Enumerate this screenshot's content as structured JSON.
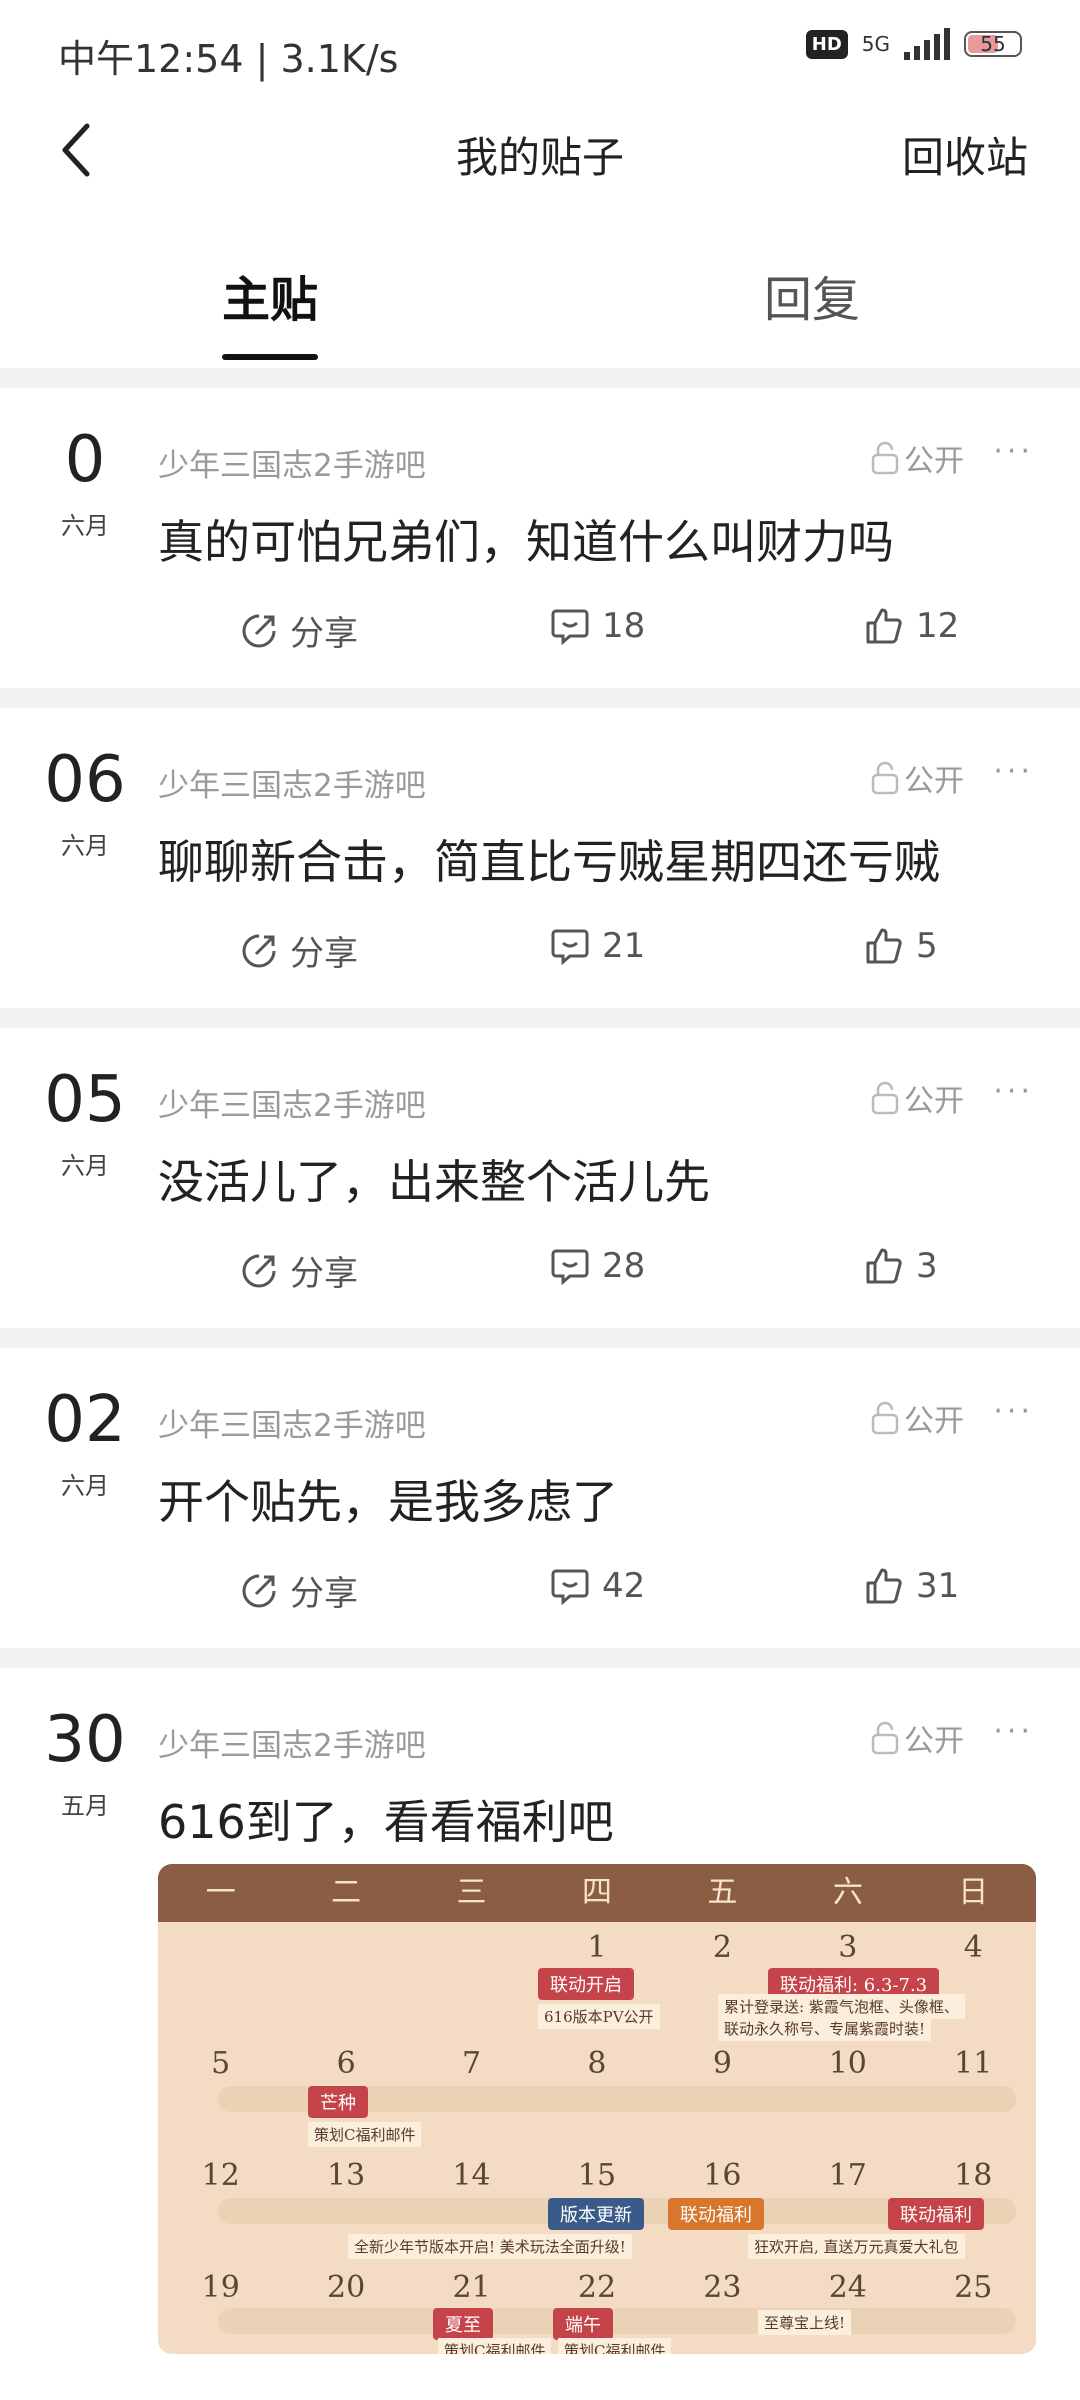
{
  "status_bar": {
    "time_speed": "中午12:54 | 3.1K/s",
    "hd": "HD",
    "network": "5G",
    "battery": "55"
  },
  "nav": {
    "title": "我的贴子",
    "recycle": "回收站"
  },
  "tabs": [
    {
      "label": "主贴"
    },
    {
      "label": "回复"
    }
  ],
  "posts": [
    {
      "day": "0",
      "month": "六月",
      "forum": "少年三国志2手游吧",
      "privacy": "公开",
      "more": "···",
      "title": "真的可怕兄弟们，知道什么叫财力吗",
      "share": "分享",
      "comments": "18",
      "likes": "12"
    },
    {
      "day": "06",
      "month": "六月",
      "forum": "少年三国志2手游吧",
      "privacy": "公开",
      "more": "···",
      "title": "聊聊新合击，简直比亏贼星期四还亏贼",
      "share": "分享",
      "comments": "21",
      "likes": "5"
    },
    {
      "day": "05",
      "month": "六月",
      "forum": "少年三国志2手游吧",
      "privacy": "公开",
      "more": "···",
      "title": "没活儿了，出来整个活儿先",
      "share": "分享",
      "comments": "28",
      "likes": "3"
    },
    {
      "day": "02",
      "month": "六月",
      "forum": "少年三国志2手游吧",
      "privacy": "公开",
      "more": "···",
      "title": "开个贴先，是我多虑了",
      "share": "分享",
      "comments": "42",
      "likes": "31"
    },
    {
      "day": "30",
      "month": "五月",
      "forum": "少年三国志2手游吧",
      "privacy": "公开",
      "more": "···",
      "title": "616到了，看看福利吧"
    }
  ],
  "calendar_image": {
    "weekdays": [
      "一",
      "二",
      "三",
      "四",
      "五",
      "六",
      "日"
    ],
    "rows": [
      [
        "",
        "",
        "",
        "1",
        "2",
        "3",
        "4"
      ],
      [
        "5",
        "6",
        "7",
        "8",
        "9",
        "10",
        "11"
      ],
      [
        "12",
        "13",
        "14",
        "15",
        "16",
        "17",
        "18"
      ],
      [
        "19",
        "20",
        "21",
        "22",
        "23",
        "24",
        "25"
      ]
    ],
    "tags": {
      "t1": "联动开启",
      "t2": "联动福利: 6.3-7.3",
      "t3": "芒种",
      "t4": "版本更新",
      "t5": "联动福利",
      "t6": "联动福利",
      "t7": "夏至",
      "t8": "端午"
    },
    "notes": {
      "n1": "616版本PV公开",
      "n2": "累计登录送: 紫霞气泡框、头像框、",
      "n3": "联动永久称号、专属紫霞时装!",
      "n4": "策划C福利邮件",
      "n5": "全新少年节版本开启! 美术玩法全面升级!",
      "n6": "狂欢开启, 直送万元真爱大礼包",
      "n7": "至尊宝上线!",
      "n8": "策划C福利邮件",
      "n9": "策划C福利邮件"
    }
  }
}
